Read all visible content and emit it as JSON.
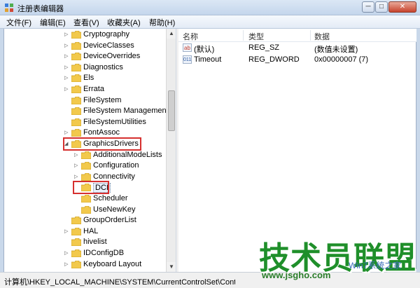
{
  "window": {
    "title": "注册表编辑器",
    "controls": {
      "minimize": "─",
      "maximize": "□",
      "close": "✕"
    }
  },
  "menu": [
    "文件(F)",
    "编辑(E)",
    "查看(V)",
    "收藏夹(A)",
    "帮助(H)"
  ],
  "tree": {
    "rows": [
      {
        "label": "Cryptography",
        "level": 0,
        "expander": "collapsed"
      },
      {
        "label": "DeviceClasses",
        "level": 0,
        "expander": "collapsed"
      },
      {
        "label": "DeviceOverrides",
        "level": 0,
        "expander": "collapsed"
      },
      {
        "label": "Diagnostics",
        "level": 0,
        "expander": "collapsed"
      },
      {
        "label": "Els",
        "level": 0,
        "expander": "collapsed"
      },
      {
        "label": "Errata",
        "level": 0,
        "expander": "collapsed"
      },
      {
        "label": "FileSystem",
        "level": 0,
        "expander": "none"
      },
      {
        "label": "FileSystem Management",
        "level": 0,
        "expander": "none"
      },
      {
        "label": "FileSystemUtilities",
        "level": 0,
        "expander": "none"
      },
      {
        "label": "FontAssoc",
        "level": 0,
        "expander": "collapsed"
      },
      {
        "label": "GraphicsDrivers",
        "level": 0,
        "expander": "expanded",
        "highlighted": true
      },
      {
        "label": "AdditionalModeLists",
        "level": 1,
        "expander": "collapsed"
      },
      {
        "label": "Configuration",
        "level": 1,
        "expander": "collapsed"
      },
      {
        "label": "Connectivity",
        "level": 1,
        "expander": "collapsed"
      },
      {
        "label": "DCI",
        "level": 1,
        "expander": "none",
        "highlighted": true,
        "selected": true
      },
      {
        "label": "Scheduler",
        "level": 1,
        "expander": "none"
      },
      {
        "label": "UseNewKey",
        "level": 1,
        "expander": "none"
      },
      {
        "label": "GroupOrderList",
        "level": 0,
        "expander": "none"
      },
      {
        "label": "HAL",
        "level": 0,
        "expander": "collapsed"
      },
      {
        "label": "hivelist",
        "level": 0,
        "expander": "none"
      },
      {
        "label": "IDConfigDB",
        "level": 0,
        "expander": "collapsed"
      },
      {
        "label": "Keyboard Layout",
        "level": 0,
        "expander": "collapsed"
      }
    ]
  },
  "list": {
    "columns": [
      "名称",
      "类型",
      "数据"
    ],
    "rows": [
      {
        "icon": "string-value-icon",
        "icon_glyph": "ab",
        "name": "(默认)",
        "type": "REG_SZ",
        "data": "(数值未设置)"
      },
      {
        "icon": "dword-value-icon",
        "icon_glyph": "011",
        "name": "Timeout",
        "type": "REG_DWORD",
        "data": "0x00000007 (7)"
      }
    ]
  },
  "status": {
    "path": "计算机\\HKEY_LOCAL_MACHINE\\SYSTEM\\CurrentControlSet\\Control\\GraphicsDrivers\\DCI"
  },
  "watermark": {
    "main": "技术员联盟",
    "url": "www.jsgho.com",
    "sub": "Win7系统之家"
  },
  "colors": {
    "highlight": "#d6302f",
    "folder": "#f2c94c",
    "watermark_green": "#1f8f2a"
  }
}
